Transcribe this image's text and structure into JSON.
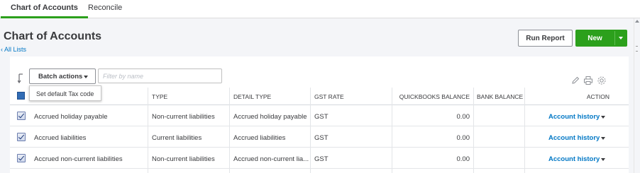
{
  "tabs": [
    {
      "label": "Chart of Accounts",
      "active": true
    },
    {
      "label": "Reconcile",
      "active": false
    }
  ],
  "page": {
    "title": "Chart of Accounts",
    "back_link": "‹ All Lists"
  },
  "toolbar": {
    "run_report_label": "Run Report",
    "new_label": "New",
    "batch_actions_label": "Batch actions",
    "filter_placeholder": "Filter by name",
    "tool_icons": [
      "pencil-icon",
      "printer-icon",
      "gear-icon"
    ]
  },
  "batch_menu": {
    "items": [
      "Set default Tax code"
    ]
  },
  "table": {
    "columns": [
      "TYPE",
      "DETAIL TYPE",
      "GST RATE",
      "QUICKBOOKS BALANCE",
      "BANK BALANCE",
      "ACTION"
    ],
    "rows": [
      {
        "name": "Accrued holiday payable",
        "type": "Non-current liabilities",
        "detail_type": "Accrued holiday payable",
        "gst_rate": "GST",
        "qb_balance": "0.00",
        "bank_balance": "",
        "action": "Account history",
        "checked": true
      },
      {
        "name": "Accrued liabilities",
        "type": "Current liabilities",
        "detail_type": "Accrued liabilities",
        "gst_rate": "GST",
        "qb_balance": "0.00",
        "bank_balance": "",
        "action": "Account history",
        "checked": true
      },
      {
        "name": "Accrued non-current liabilities",
        "type": "Non-current liabilities",
        "detail_type": "Accrued non-current lia...",
        "gst_rate": "GST",
        "qb_balance": "0.00",
        "bank_balance": "",
        "action": "Account history",
        "checked": true
      }
    ]
  },
  "colors": {
    "accent_green": "#2ca01c",
    "link_blue": "#0077c5",
    "text_dark": "#393a3d"
  }
}
